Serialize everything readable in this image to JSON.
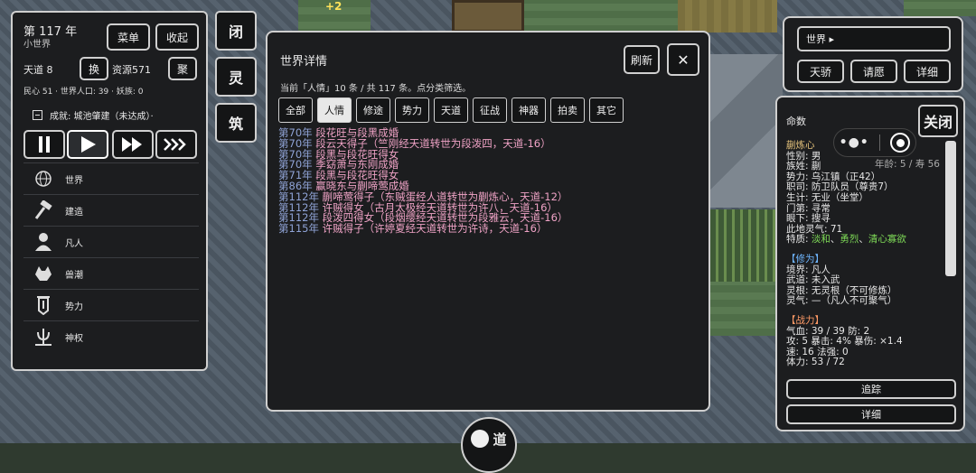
{
  "left": {
    "year": "第 117 年",
    "world_name": "小世界",
    "menu_btn": "菜单",
    "collapse_btn": "收起",
    "tiandao": "天道 8",
    "swap_btn": "换",
    "resource": "资源571",
    "gather_btn": "聚",
    "stats": "民心 51 · 世界人口: 39 · 妖族: 0",
    "achievement": "成就: 城池肇建（未达成）·",
    "menu": [
      "世界",
      "建造",
      "凡人",
      "兽潮",
      "势力",
      "神权"
    ]
  },
  "sidetabs": [
    "闭",
    "灵",
    "筑"
  ],
  "world": {
    "title": "世界详情",
    "refresh": "刷新",
    "close": "✕",
    "summary": "当前「人情」10 条 / 共 117 条。点分类筛选。",
    "filters": [
      "全部",
      "人情",
      "修途",
      "势力",
      "天道",
      "征战",
      "神器",
      "拍卖",
      "其它"
    ],
    "selected_filter": 1,
    "events": [
      {
        "y": "第70年",
        "t": "段花旺与段黑成婚"
      },
      {
        "y": "第70年",
        "t": "段云天得子（竺刚经天道转世为段泼四，天道-16）"
      },
      {
        "y": "第70年",
        "t": "段黑与段花旺得女"
      },
      {
        "y": "第70年",
        "t": "季窈萧与东刚成婚"
      },
      {
        "y": "第71年",
        "t": "段黑与段花旺得女"
      },
      {
        "y": "第86年",
        "t": "赢晓东与蒯啼莺成婚"
      },
      {
        "y": "第112年",
        "t": "蒯啼莺得子（东贼蛋经人道转世为蒯炼心，天道-12）"
      },
      {
        "y": "第112年",
        "t": "许贼得女（古月太极经天道转世为许八，天道-16）"
      },
      {
        "y": "第112年",
        "t": "段泼四得女（段烟缨经天道转世为段雅云，天道-16）"
      },
      {
        "y": "第115年",
        "t": "许贼得子（许婷夏经天道转世为许诗，天道-16）"
      }
    ]
  },
  "rtop": {
    "world_select": "世界 ▸",
    "btns": [
      "天骄",
      "请愿",
      "详细"
    ]
  },
  "rinfo": {
    "header": "命数",
    "close": "关闭",
    "name": "蒯炼心",
    "lines": [
      "性别: 男",
      "族姓: 蒯",
      "势力: 乌江镇（正42）",
      "职司: 防卫队员（尊贵7）",
      "生计: 无业（坐堂）",
      "门第: 寻常",
      "眼下: 搜寻",
      "此地灵气: 71"
    ],
    "age": "年龄: 5 / 寿 56",
    "traits_label": "特质: ",
    "traits": [
      "淡和",
      "勇烈",
      "清心寡欲"
    ],
    "cultivation_header": "【修为】",
    "cultivation": [
      "境界: 凡人",
      "武道: 未入武",
      "灵根: 无灵根（不可修炼）",
      "灵气: —（凡人不可聚气）"
    ],
    "combat_header": "【战力】",
    "combat": [
      "气血: 39 / 39  防: 2",
      "攻: 5  暴击: 4%  暴伤: ×1.4",
      "速: 16  法强: 0",
      "体力: 53 / 72"
    ],
    "track_btn": "追踪",
    "detail_btn": "详细"
  },
  "bottom": {
    "label": "道"
  },
  "map": {
    "float_text": "+2"
  }
}
